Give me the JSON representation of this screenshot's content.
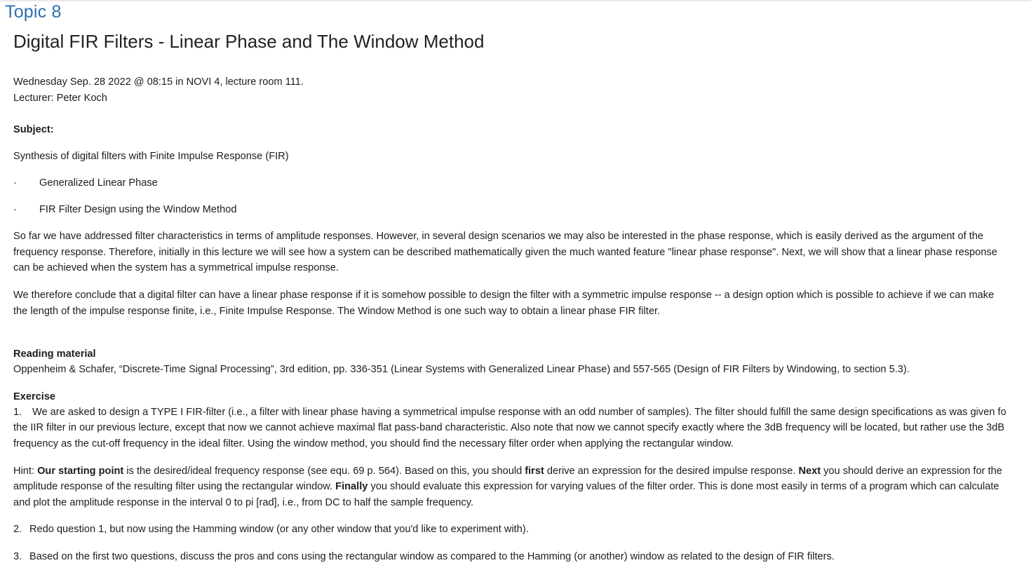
{
  "topic": "Topic 8",
  "title": "Digital FIR Filters - Linear Phase and The Window Method",
  "meta": {
    "datetime": "Wednesday Sep. 28 2022 @ 08:15 in NOVI 4, lecture room 111.",
    "lecturer": "Lecturer: Peter Koch"
  },
  "subject": {
    "label": "Subject:",
    "text": "Synthesis of digital filters with Finite Impulse Response (FIR)",
    "bullets": [
      {
        "dot": "·",
        "text": "Generalized Linear Phase"
      },
      {
        "dot": "·",
        "text": "FIR Filter Design using the Window Method"
      }
    ]
  },
  "paragraphs": {
    "p1_line1": "So far we have addressed filter characteristics in terms of amplitude responses. However, in several design scenarios we may also be interested in the phase response, which is easily derived as the argument of the",
    "p1_line2": "frequency response. Therefore, initially in this lecture we will see how a system can be described mathematically given the much wanted feature \"linear phase response\". Next, we will show that a linear phase response",
    "p1_line3": "can be achieved when the system has a symmetrical impulse response.",
    "p2_line1": "We therefore conclude that a digital filter can have a linear phase response if it is somehow possible to design the filter with a symmetric impulse response -- a design option which is possible to achieve if we can make",
    "p2_line2": "the length of the impulse response finite, i.e., Finite Impulse Response. The Window Method is one such way to obtain a linear phase FIR filter."
  },
  "reading": {
    "label": "Reading material",
    "text": "Oppenheim & Schafer, “Discrete-Time Signal Processing”, 3rd edition, pp. 336-351 (Linear Systems with Generalized Linear Phase) and 557-565 (Design of FIR Filters by Windowing, to section 5.3)."
  },
  "exercise": {
    "label": "Exercise",
    "q1_num": "1.",
    "q1_line1": "We are asked to design a TYPE I FIR-filter (i.e., a filter with linear phase having a symmetrical impulse response with an odd number of samples). The filter should fulfill the same design specifications as was given fo",
    "q1_line2": "the IIR filter in our previous lecture, except that now we cannot achieve maximal flat pass-band characteristic. Also note that now we cannot specify exactly where the 3dB frequency will be located, but rather use the 3dB",
    "q1_line3": "frequency as the cut-off frequency in the ideal filter. Using the window method, you should find the necessary filter order when applying the rectangular window.",
    "hint": {
      "prefix": "Hint: ",
      "b1": "Our starting point",
      "t1": " is the desired/ideal frequency response (see equ. 69 p. 564). Based on this, you should ",
      "b2": "first",
      "t2": " derive an expression for the desired impulse response. ",
      "b3": "Next",
      "t3": " you should derive an expression for the",
      "line2_t1": "amplitude response of the resulting filter using the rectangular window. ",
      "b4": "Finally",
      "line2_t2": " you should evaluate this expression for varying values of the filter order. This is done most easily in terms of a program which can calculate",
      "line3": "and plot the amplitude response in the interval 0 to pi [rad], i.e., from DC to half the sample frequency."
    },
    "q2_num": "2.",
    "q2": "Redo question 1, but now using the Hamming window (or any other window that you'd like to experiment with).",
    "q3_num": "3.",
    "q3": "Based on the first two questions, discuss the pros and cons using the rectangular window as compared to the Hamming (or another) window as related to the design of FIR filters."
  }
}
